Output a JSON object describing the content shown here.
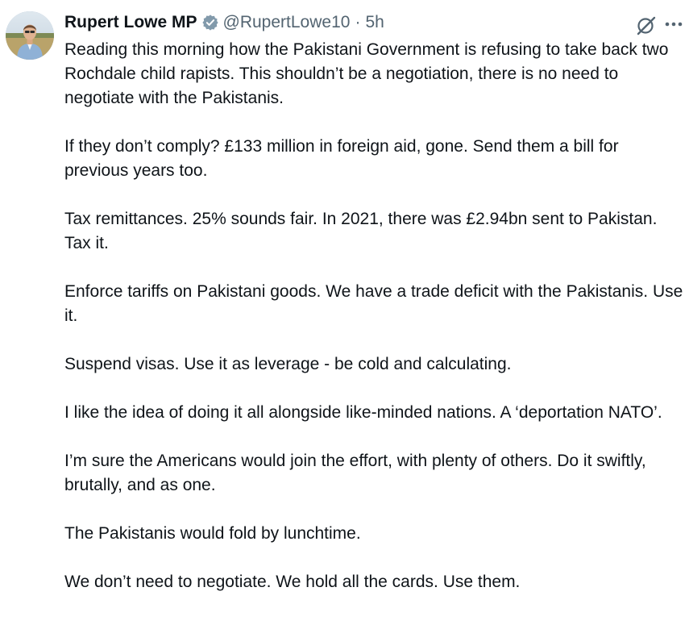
{
  "tweet": {
    "author": {
      "display_name": "Rupert Lowe MP",
      "handle": "@RupertLowe10",
      "separator": "·",
      "time": "5h",
      "avatar_icon": "profile-photo",
      "verified_badge": "gold-verified-badge-icon"
    },
    "actions": {
      "grok_icon": "grok-icon",
      "more_icon": "more-options-icon"
    },
    "colors": {
      "text": "#0f1419",
      "secondary": "#536471",
      "verified_badge": "#829aab"
    },
    "paragraphs": [
      "Reading this morning how the Pakistani Government is refusing to take back two Rochdale child rapists. This shouldn’t be a negotiation, there is no need to negotiate with the Pakistanis.",
      "If they don’t comply? £133 million in foreign aid, gone. Send them a bill for previous years too.",
      "Tax remittances. 25% sounds fair. In 2021, there was £2.94bn sent to Pakistan. Tax it.",
      "Enforce tariffs on Pakistani goods. We have a trade deficit with the Pakistanis. Use it.",
      "Suspend visas. Use it as leverage - be cold and calculating.",
      "I like the idea of doing it all alongside like-minded nations. A ‘deportation NATO’.",
      "I’m sure the Americans would join the effort, with plenty of others. Do it swiftly, brutally, and as one.",
      "The Pakistanis would fold by lunchtime.",
      "We don’t need to negotiate. We hold all the cards. Use them."
    ]
  }
}
